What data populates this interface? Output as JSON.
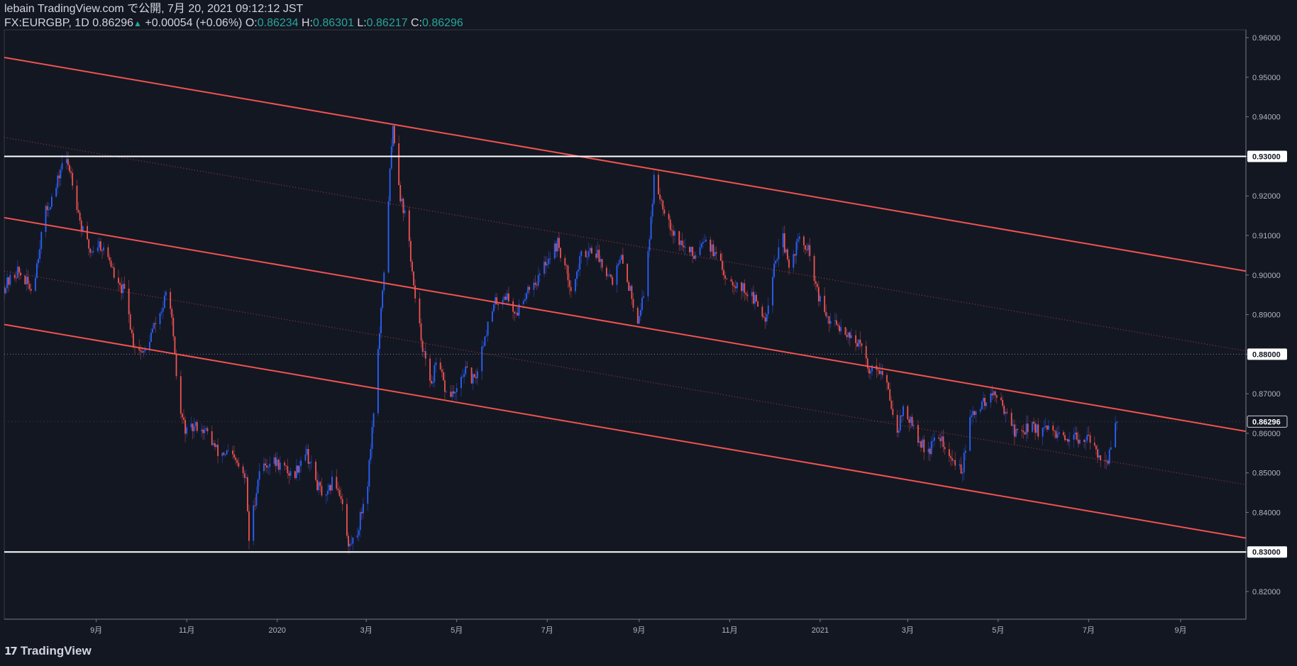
{
  "header": {
    "publish_line": "lebain TradingView.com で公開, 7月 20, 2021 09:12:12 JST",
    "symbol": "FX:EURGBP, 1D",
    "last": "0.86296",
    "change_arrow": "▲",
    "change": "+0.00054 (+0.06%)",
    "o_label": "O:",
    "o_value": "0.86234",
    "h_label": "H:",
    "h_value": "0.86301",
    "l_label": "L:",
    "l_value": "0.86217",
    "c_label": "C:",
    "c_value": "0.86296"
  },
  "footer": {
    "logo_icon": "tradingview-logo-icon",
    "brand": "TradingView"
  },
  "colors": {
    "background": "#131722",
    "up": "#2962ff",
    "down": "#ef5350",
    "channel": "#f05350",
    "level": "#ffffff",
    "text": "#d1d4dc",
    "green": "#26a69a"
  },
  "chart_data": {
    "type": "candlestick",
    "symbol": "FX:EURGBP",
    "interval": "1D",
    "x_range": [
      "2019-07-01",
      "2021-10-15"
    ],
    "ylim": [
      0.813,
      0.962
    ],
    "y_ticks": [
      "0.82000",
      "0.83000",
      "0.84000",
      "0.85000",
      "0.86000",
      "0.87000",
      "0.88000",
      "0.89000",
      "0.90000",
      "0.91000",
      "0.92000",
      "0.93000",
      "0.94000",
      "0.95000",
      "0.96000"
    ],
    "x_ticks": [
      {
        "date": "2019-09-01",
        "label": "9月"
      },
      {
        "date": "2019-11-01",
        "label": "11月"
      },
      {
        "date": "2020-01-01",
        "label": "2020"
      },
      {
        "date": "2020-03-01",
        "label": "3月"
      },
      {
        "date": "2020-05-01",
        "label": "5月"
      },
      {
        "date": "2020-07-01",
        "label": "7月"
      },
      {
        "date": "2020-09-01",
        "label": "9月"
      },
      {
        "date": "2020-11-01",
        "label": "11月"
      },
      {
        "date": "2021-01-01",
        "label": "2021"
      },
      {
        "date": "2021-03-01",
        "label": "3月"
      },
      {
        "date": "2021-05-01",
        "label": "5月"
      },
      {
        "date": "2021-07-01",
        "label": "7月"
      },
      {
        "date": "2021-09-01",
        "label": "9月"
      }
    ],
    "price_path": [
      [
        "2019-07-01",
        0.897
      ],
      [
        "2019-07-10",
        0.901
      ],
      [
        "2019-07-20",
        0.896
      ],
      [
        "2019-07-28",
        0.915
      ],
      [
        "2019-08-05",
        0.922
      ],
      [
        "2019-08-10",
        0.93
      ],
      [
        "2019-08-15",
        0.926
      ],
      [
        "2019-08-22",
        0.912
      ],
      [
        "2019-08-28",
        0.906
      ],
      [
        "2019-09-03",
        0.908
      ],
      [
        "2019-09-10",
        0.904
      ],
      [
        "2019-09-15",
        0.897
      ],
      [
        "2019-09-20",
        0.896
      ],
      [
        "2019-09-26",
        0.883
      ],
      [
        "2019-10-03",
        0.88
      ],
      [
        "2019-10-09",
        0.886
      ],
      [
        "2019-10-16",
        0.892
      ],
      [
        "2019-10-20",
        0.898
      ],
      [
        "2019-10-23",
        0.883
      ],
      [
        "2019-10-27",
        0.866
      ],
      [
        "2019-11-01",
        0.86
      ],
      [
        "2019-11-08",
        0.862
      ],
      [
        "2019-11-15",
        0.86
      ],
      [
        "2019-11-22",
        0.855
      ],
      [
        "2019-11-29",
        0.855
      ],
      [
        "2019-12-05",
        0.852
      ],
      [
        "2019-12-11",
        0.848
      ],
      [
        "2019-12-13",
        0.833
      ],
      [
        "2019-12-20",
        0.851
      ],
      [
        "2019-12-28",
        0.853
      ],
      [
        "2020-01-03",
        0.852
      ],
      [
        "2020-01-12",
        0.849
      ],
      [
        "2020-01-20",
        0.856
      ],
      [
        "2020-01-28",
        0.847
      ],
      [
        "2020-02-03",
        0.843
      ],
      [
        "2020-02-08",
        0.849
      ],
      [
        "2020-02-14",
        0.843
      ],
      [
        "2020-02-18",
        0.831
      ],
      [
        "2020-02-24",
        0.835
      ],
      [
        "2020-03-02",
        0.848
      ],
      [
        "2020-03-06",
        0.866
      ],
      [
        "2020-03-12",
        0.895
      ],
      [
        "2020-03-19",
        0.938
      ],
      [
        "2020-03-24",
        0.92
      ],
      [
        "2020-03-29",
        0.912
      ],
      [
        "2020-04-03",
        0.893
      ],
      [
        "2020-04-09",
        0.88
      ],
      [
        "2020-04-13",
        0.872
      ],
      [
        "2020-04-18",
        0.878
      ],
      [
        "2020-04-24",
        0.87
      ],
      [
        "2020-05-01",
        0.87
      ],
      [
        "2020-05-06",
        0.876
      ],
      [
        "2020-05-13",
        0.873
      ],
      [
        "2020-05-20",
        0.885
      ],
      [
        "2020-05-27",
        0.893
      ],
      [
        "2020-06-03",
        0.895
      ],
      [
        "2020-06-10",
        0.89
      ],
      [
        "2020-06-18",
        0.897
      ],
      [
        "2020-06-25",
        0.899
      ],
      [
        "2020-07-01",
        0.904
      ],
      [
        "2020-07-08",
        0.908
      ],
      [
        "2020-07-13",
        0.902
      ],
      [
        "2020-07-18",
        0.896
      ],
      [
        "2020-07-24",
        0.905
      ],
      [
        "2020-08-01",
        0.907
      ],
      [
        "2020-08-07",
        0.903
      ],
      [
        "2020-08-14",
        0.899
      ],
      [
        "2020-08-20",
        0.904
      ],
      [
        "2020-08-26",
        0.896
      ],
      [
        "2020-08-31",
        0.889
      ],
      [
        "2020-09-04",
        0.895
      ],
      [
        "2020-09-08",
        0.91
      ],
      [
        "2020-09-11",
        0.924
      ],
      [
        "2020-09-17",
        0.918
      ],
      [
        "2020-09-24",
        0.911
      ],
      [
        "2020-10-01",
        0.907
      ],
      [
        "2020-10-08",
        0.905
      ],
      [
        "2020-10-15",
        0.91
      ],
      [
        "2020-10-22",
        0.905
      ],
      [
        "2020-10-29",
        0.9
      ],
      [
        "2020-11-05",
        0.898
      ],
      [
        "2020-11-12",
        0.896
      ],
      [
        "2020-11-19",
        0.893
      ],
      [
        "2020-11-25",
        0.889
      ],
      [
        "2020-12-01",
        0.903
      ],
      [
        "2020-12-07",
        0.909
      ],
      [
        "2020-12-11",
        0.901
      ],
      [
        "2020-12-17",
        0.909
      ],
      [
        "2020-12-24",
        0.906
      ],
      [
        "2020-12-31",
        0.894
      ],
      [
        "2021-01-07",
        0.888
      ],
      [
        "2021-01-14",
        0.887
      ],
      [
        "2021-01-21",
        0.885
      ],
      [
        "2021-01-28",
        0.882
      ],
      [
        "2021-02-03",
        0.876
      ],
      [
        "2021-02-09",
        0.877
      ],
      [
        "2021-02-15",
        0.872
      ],
      [
        "2021-02-22",
        0.861
      ],
      [
        "2021-02-26",
        0.866
      ],
      [
        "2021-03-04",
        0.862
      ],
      [
        "2021-03-10",
        0.857
      ],
      [
        "2021-03-16",
        0.856
      ],
      [
        "2021-03-22",
        0.86
      ],
      [
        "2021-03-28",
        0.854
      ],
      [
        "2021-04-03",
        0.852
      ],
      [
        "2021-04-07",
        0.851
      ],
      [
        "2021-04-11",
        0.862
      ],
      [
        "2021-04-16",
        0.866
      ],
      [
        "2021-04-22",
        0.868
      ],
      [
        "2021-04-28",
        0.87
      ],
      [
        "2021-05-03",
        0.867
      ],
      [
        "2021-05-07",
        0.866
      ],
      [
        "2021-05-12",
        0.86
      ],
      [
        "2021-05-18",
        0.861
      ],
      [
        "2021-05-24",
        0.862
      ],
      [
        "2021-05-30",
        0.86
      ],
      [
        "2021-06-05",
        0.861
      ],
      [
        "2021-06-11",
        0.859
      ],
      [
        "2021-06-17",
        0.857
      ],
      [
        "2021-06-23",
        0.859
      ],
      [
        "2021-06-29",
        0.859
      ],
      [
        "2021-07-05",
        0.856
      ],
      [
        "2021-07-10",
        0.854
      ],
      [
        "2021-07-14",
        0.853
      ],
      [
        "2021-07-17",
        0.858
      ],
      [
        "2021-07-20",
        0.86296
      ]
    ],
    "channel_lines": [
      {
        "start": [
          "2019-07-01",
          0.955
        ],
        "end": [
          "2021-10-15",
          0.901
        ],
        "style": "solid"
      },
      {
        "start": [
          "2019-07-01",
          0.9145
        ],
        "end": [
          "2021-10-15",
          0.8605
        ],
        "style": "solid"
      },
      {
        "start": [
          "2019-07-01",
          0.8875
        ],
        "end": [
          "2021-10-15",
          0.8335
        ],
        "style": "solid"
      },
      {
        "start": [
          "2019-07-01",
          0.9348
        ],
        "end": [
          "2021-10-15",
          0.8808
        ],
        "style": "dotted"
      },
      {
        "start": [
          "2019-07-01",
          0.901
        ],
        "end": [
          "2021-10-15",
          0.847
        ],
        "style": "dotted"
      }
    ],
    "horizontal_levels": [
      {
        "price": 0.93,
        "label": "0.93000"
      },
      {
        "price": 0.83,
        "label": "0.83000"
      }
    ],
    "reference_levels": [
      {
        "price": 0.88,
        "label": "0.88000"
      }
    ],
    "last_price": {
      "price": 0.86296,
      "label": "0.86296"
    }
  }
}
